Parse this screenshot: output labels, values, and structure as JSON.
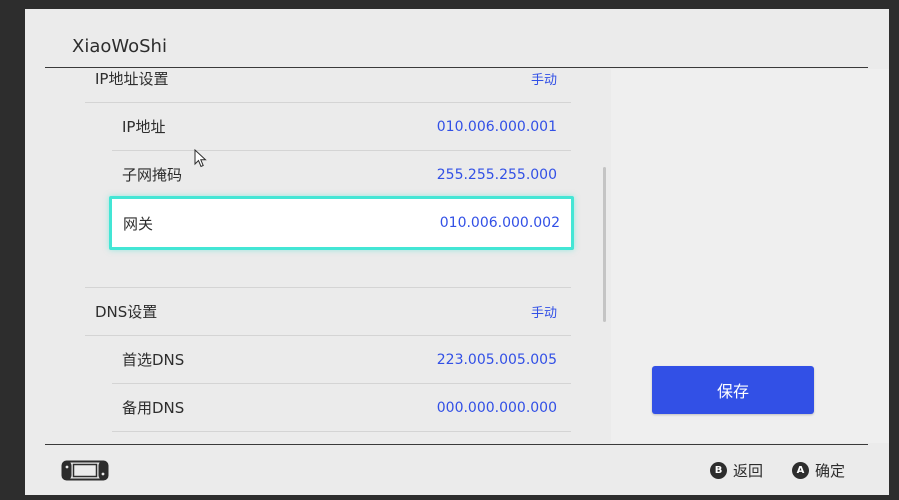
{
  "header": {
    "title": "XiaoWoShi"
  },
  "sections": {
    "ip": {
      "label": "IP地址设置",
      "mode": "手动",
      "items": [
        {
          "label": "IP地址",
          "value": "010.006.000.001"
        },
        {
          "label": "子网掩码",
          "value": "255.255.255.000"
        },
        {
          "label": "网关",
          "value": "010.006.000.002"
        }
      ]
    },
    "dns": {
      "label": "DNS设置",
      "mode": "手动",
      "items": [
        {
          "label": "首选DNS",
          "value": "223.005.005.005"
        },
        {
          "label": "备用DNS",
          "value": "000.000.000.000"
        }
      ]
    }
  },
  "actions": {
    "save_label": "保存"
  },
  "footer": {
    "back": {
      "button": "B",
      "label": "返回"
    },
    "ok": {
      "button": "A",
      "label": "确定"
    }
  },
  "colors": {
    "accent": "#3250e6",
    "selection": "#43e6d5",
    "background": "#ebebeb",
    "frame": "#2d2d2d"
  },
  "icons": {
    "console": "switch-console-icon",
    "pointer": "mouse-cursor-icon"
  }
}
